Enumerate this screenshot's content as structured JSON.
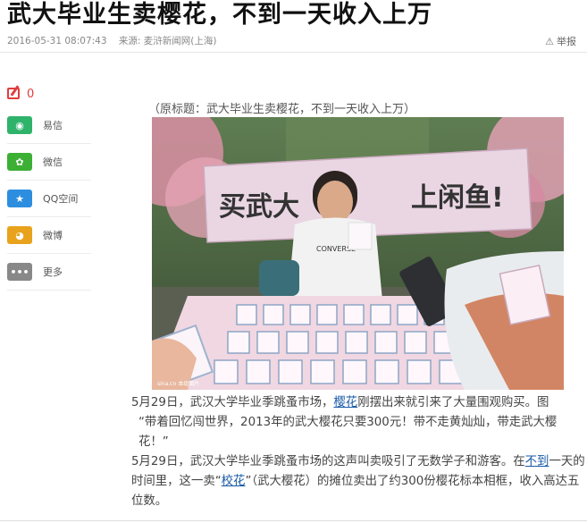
{
  "article": {
    "title": "武大毕业生卖樱花，不到一天收入上万",
    "date": "2016-05-31 08:07:43",
    "source": "来源: 麦浒新闻网(上海)",
    "report_label": "举报",
    "caption": "（原标题：武大毕业生卖樱花，不到一天收入上万）"
  },
  "sidebar": {
    "comment_count": "0",
    "share": [
      {
        "label": "易信",
        "icon": "yixin-icon",
        "color": "#2fb36b",
        "glyph": "◉"
      },
      {
        "label": "微信",
        "icon": "wechat-icon",
        "color": "#3cb034",
        "glyph": "✿"
      },
      {
        "label": "QQ空间",
        "icon": "qzone-icon",
        "color": "#2d8ee0",
        "glyph": "★"
      },
      {
        "label": "微博",
        "icon": "weibo-icon",
        "color": "#e8a21c",
        "glyph": "◕"
      },
      {
        "label": "更多",
        "icon": "more-icon",
        "color": "#888888",
        "glyph": "•••"
      }
    ]
  },
  "photo": {
    "banner_text": "买武大",
    "banner_text_right": "上闲鱼!",
    "tshirt_text": "CONVERSE",
    "watermark": "sina.cn 本组图片"
  },
  "paragraphs": {
    "p1_a": "5月29日，武汉大学毕业季跳蚤市场，",
    "p1_link": "樱花",
    "p1_b": "刚摆出来就引来了大量围观购买。图",
    "p2": "“带着回忆闯世界，2013年的武大樱花只要300元！带不走黄灿灿，带走武大樱花！”",
    "p3_a": "5月29日，武汉大学毕业季跳蚤市场的这声叫卖吸引了无数学子和游客。在",
    "p3_link1": "不到",
    "p3_b": "一天的时间里，这一卖“",
    "p3_link2": "校花",
    "p3_c": "”（武大樱花）的摊位卖出了约300份樱花标本相框，收入高达五位数。"
  }
}
